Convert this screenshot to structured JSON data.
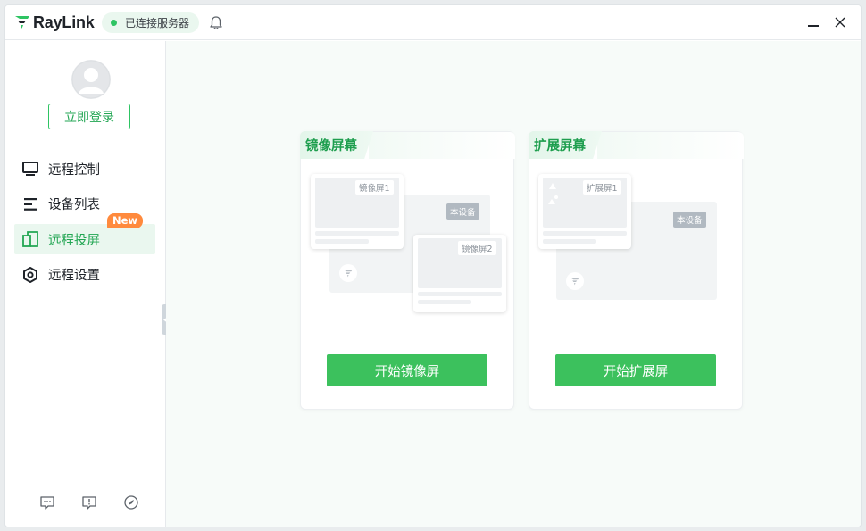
{
  "app": {
    "logo_text": "RayLink",
    "status_text": "已连接服务器"
  },
  "sidebar": {
    "login_label": "立即登录",
    "items": [
      {
        "label": "远程控制",
        "icon": "monitor-icon"
      },
      {
        "label": "设备列表",
        "icon": "list-icon"
      },
      {
        "label": "远程投屏",
        "icon": "cast-screen-icon",
        "badge": "New",
        "active": true
      },
      {
        "label": "远程设置",
        "icon": "settings-hexagon-icon"
      }
    ]
  },
  "main": {
    "cards": [
      {
        "title": "镜像屏幕",
        "button_label": "开始镜像屏",
        "screen1_label": "镜像屏1",
        "screen2_label": "镜像屏2",
        "device_label": "本设备"
      },
      {
        "title": "扩展屏幕",
        "button_label": "开始扩展屏",
        "screen1_label": "扩展屏1",
        "device_label": "本设备"
      }
    ]
  },
  "colors": {
    "accent": "#3cc15d",
    "accent_text": "#22a653",
    "badge": "#ff8a3d"
  }
}
